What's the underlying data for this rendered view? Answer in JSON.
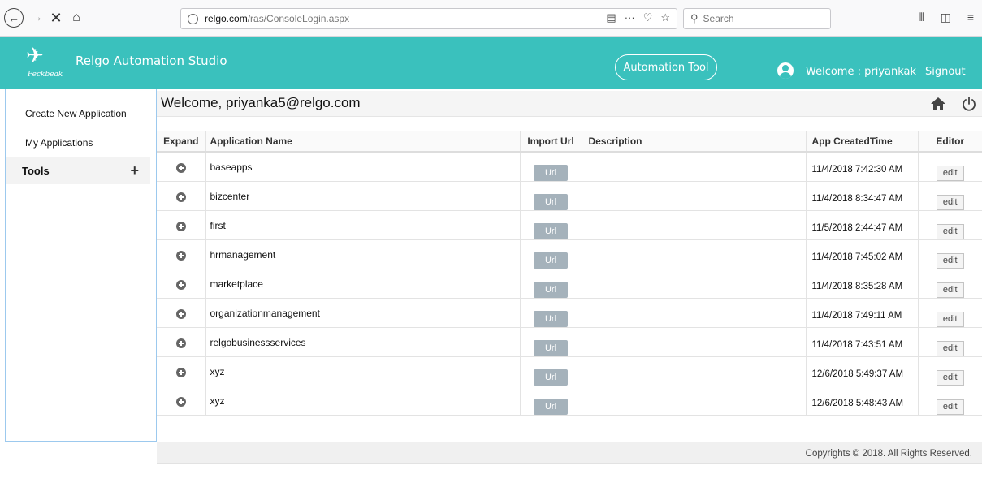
{
  "browser": {
    "url_host": "relgo.com",
    "url_path": "/ras/ConsoleLogin.aspx",
    "search_placeholder": "Search"
  },
  "header": {
    "logo_text": "Peckbeak",
    "title": "Relgo Automation Studio",
    "automation_tool_label": "Automation Tool",
    "welcome_user": "Welcome : priyankak",
    "signout_label": "Signout",
    "accent_color": "#3ac1bd"
  },
  "sidebar": {
    "items": [
      {
        "label": "Create New Application"
      },
      {
        "label": "My Applications"
      },
      {
        "label": "Tools"
      }
    ]
  },
  "main": {
    "welcome": "Welcome, priyanka5@relgo.com",
    "columns": {
      "expand": "Expand",
      "name": "Application Name",
      "import_url": "Import Url",
      "description": "Description",
      "created": "App CreatedTime",
      "editor": "Editor"
    },
    "url_label": "Url",
    "edit_label": "edit",
    "rows": [
      {
        "name": "baseapps",
        "description": "",
        "created": "11/4/2018 7:42:30 AM"
      },
      {
        "name": "bizcenter",
        "description": "",
        "created": "11/4/2018 8:34:47 AM"
      },
      {
        "name": "first",
        "description": "",
        "created": "11/5/2018 2:44:47 AM"
      },
      {
        "name": "hrmanagement",
        "description": "",
        "created": "11/4/2018 7:45:02 AM"
      },
      {
        "name": "marketplace",
        "description": "",
        "created": "11/4/2018 8:35:28 AM"
      },
      {
        "name": "organizationmanagement",
        "description": "",
        "created": "11/4/2018 7:49:11 AM"
      },
      {
        "name": "relgobusinessservices",
        "description": "",
        "created": "11/4/2018 7:43:51 AM"
      },
      {
        "name": "xyz",
        "description": "",
        "created": "12/6/2018 5:49:37 AM"
      },
      {
        "name": "xyz",
        "description": "",
        "created": "12/6/2018 5:48:43 AM"
      }
    ]
  },
  "footer": {
    "copyright": "Copyrights © 2018. All Rights Reserved."
  }
}
